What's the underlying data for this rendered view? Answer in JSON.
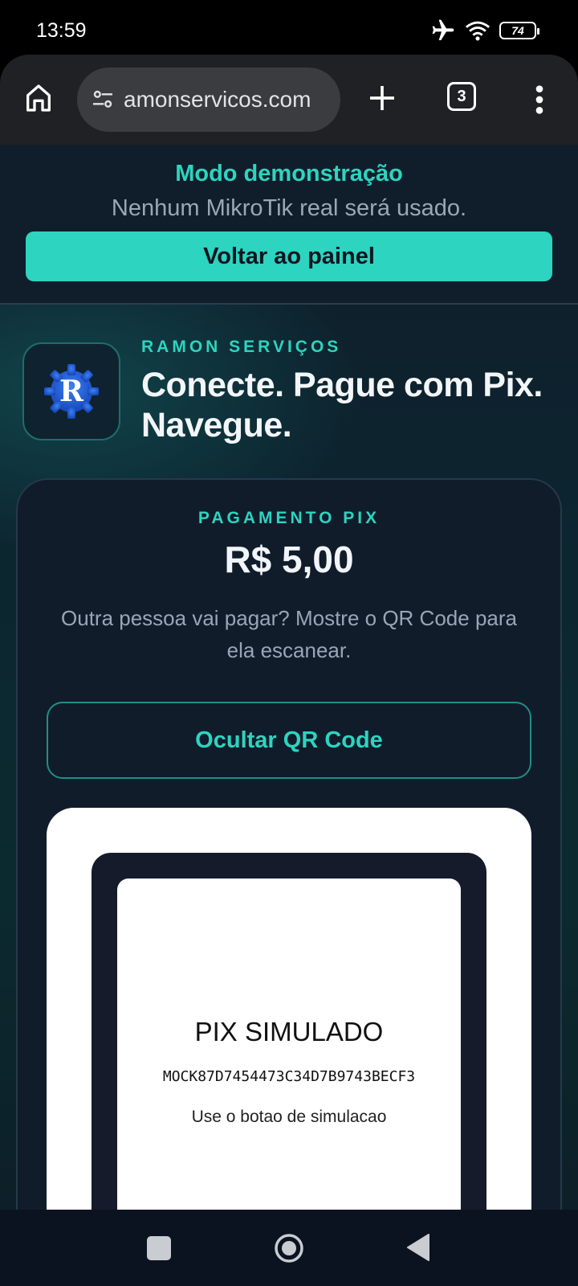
{
  "status_bar": {
    "time": "13:59",
    "battery": "74",
    "icons": [
      "airplane-icon",
      "wifi-icon",
      "battery-icon"
    ]
  },
  "browser": {
    "url": "amonservicos.com",
    "tab_count": "3",
    "icons": [
      "home-icon",
      "site-settings-icon",
      "new-tab-icon",
      "tabs-icon",
      "more-vert-icon"
    ]
  },
  "demo_banner": {
    "title": "Modo demonstração",
    "subtitle": "Nenhum MikroTik real será usado.",
    "back_button": "Voltar ao painel"
  },
  "brand": {
    "kicker": "RAMON SERVIÇOS",
    "headline": "Conecte. Pague com Pix. Navegue.",
    "logo_letter": "R"
  },
  "payment": {
    "kicker": "PAGAMENTO PIX",
    "amount": "R$ 5,00",
    "note": "Outra pessoa vai pagar? Mostre o QR Code para ela escanear.",
    "toggle_qr_button": "Ocultar QR Code"
  },
  "qr": {
    "title": "PIX SIMULADO",
    "code": "MOCK87D7454473C34D7B9743BECF3",
    "hint": "Use o botao de simulacao"
  },
  "colors": {
    "accent": "#2dd4bf",
    "background": "#0f1d2a",
    "card": "#111c2b"
  }
}
